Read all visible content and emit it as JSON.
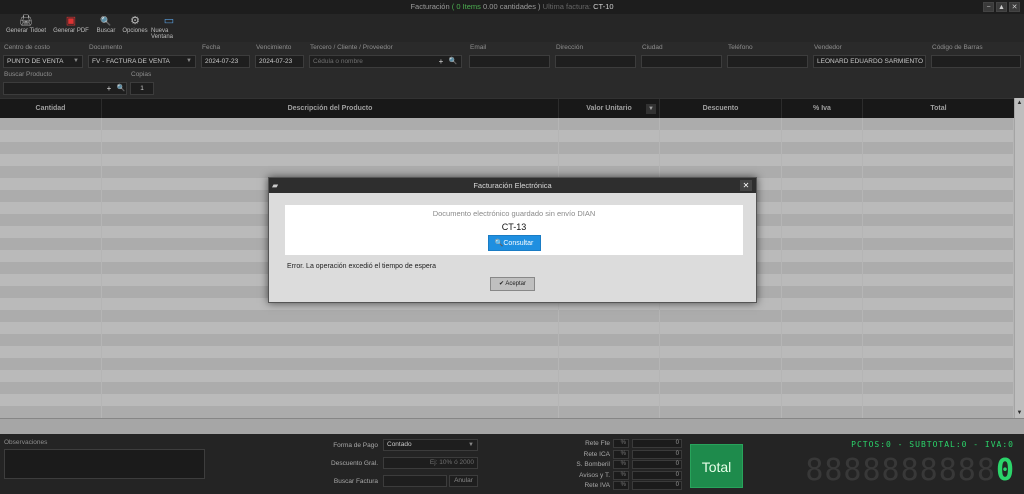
{
  "titlebar": {
    "title": "Facturación",
    "items": "( 0 Items",
    "amount": "0.00 cantidades )",
    "last_label": "Ultima factura:",
    "last_doc": "CT-10",
    "btn_min": "−",
    "btn_max": "▲",
    "btn_close": "✕"
  },
  "toolbar": [
    {
      "label": "Generar Tidoet",
      "icon": "printer-icon",
      "glyph": "🖨"
    },
    {
      "label": "Generar PDF",
      "icon": "pdf-icon",
      "glyph": "▣"
    },
    {
      "label": "Buscar",
      "icon": "search-icon",
      "glyph": "🔍"
    },
    {
      "label": "Opciones",
      "icon": "gear-icon",
      "glyph": "⚙"
    },
    {
      "label": "Nueva Ventana",
      "icon": "monitor-icon",
      "glyph": "▭"
    }
  ],
  "header": {
    "centro_costo_label": "Centro de costo",
    "centro_costo_value": "PUNTO DE VENTA",
    "documento_label": "Documento",
    "documento_value": "FV - FACTURA DE VENTA",
    "fecha_label": "Fecha",
    "fecha_value": "2024-07-23",
    "vencimiento_label": "Vencimiento",
    "vencimiento_value": "2024-07-23",
    "tercero_label": "Tercero / Cliente / Proveedor",
    "tercero_placeholder": "Cédula o nombre",
    "email_label": "Email",
    "direccion_label": "Dirección",
    "ciudad_label": "Ciudad",
    "telefono_label": "Teléfono",
    "vendedor_label": "Vendedor",
    "vendedor_value": "LEONARD EDUARDO SARMIENTO",
    "codigo_barras_label": "Código de Barras",
    "buscar_producto_label": "Buscar Producto",
    "copias_label": "Copias",
    "copias_value": "1"
  },
  "grid": {
    "columns": [
      "Cantidad",
      "Descripción del Producto",
      "Valor Unitario",
      "Descuento",
      "% Iva",
      "Total"
    ]
  },
  "dialog": {
    "title": "Facturación Electrónica",
    "message": "Documento electrónico guardado sin envío DIAN",
    "code": "CT-13",
    "consult_label": "Consultar",
    "error": "Error. La operación excedió el tiempo de espera",
    "accept_label": "Aceptar"
  },
  "footer": {
    "observaciones_label": "Observaciones",
    "forma_pago_label": "Forma de Pago",
    "forma_pago_value": "Contado",
    "descuento_label": "Descuento Gral.",
    "descuento_placeholder": "Ej: 10% ó 2000",
    "buscar_factura_label": "Buscar Factura",
    "anular_label": "Anular",
    "retenciones": [
      {
        "label": "Rete Fte",
        "pct": "%",
        "value": "0"
      },
      {
        "label": "Rete ICA",
        "pct": "%",
        "value": "0"
      },
      {
        "label": "S. Bomberil",
        "pct": "%",
        "value": "0"
      },
      {
        "label": "Avisos y T.",
        "pct": "%",
        "value": "0"
      },
      {
        "label": "Rete IVA",
        "pct": "%",
        "value": "0"
      }
    ],
    "total_label": "Total",
    "stats": "PCTOS:0 - SUBTOTAL:0 - IVA:0",
    "lcd_off": "8888888888",
    "lcd_on": "0"
  }
}
